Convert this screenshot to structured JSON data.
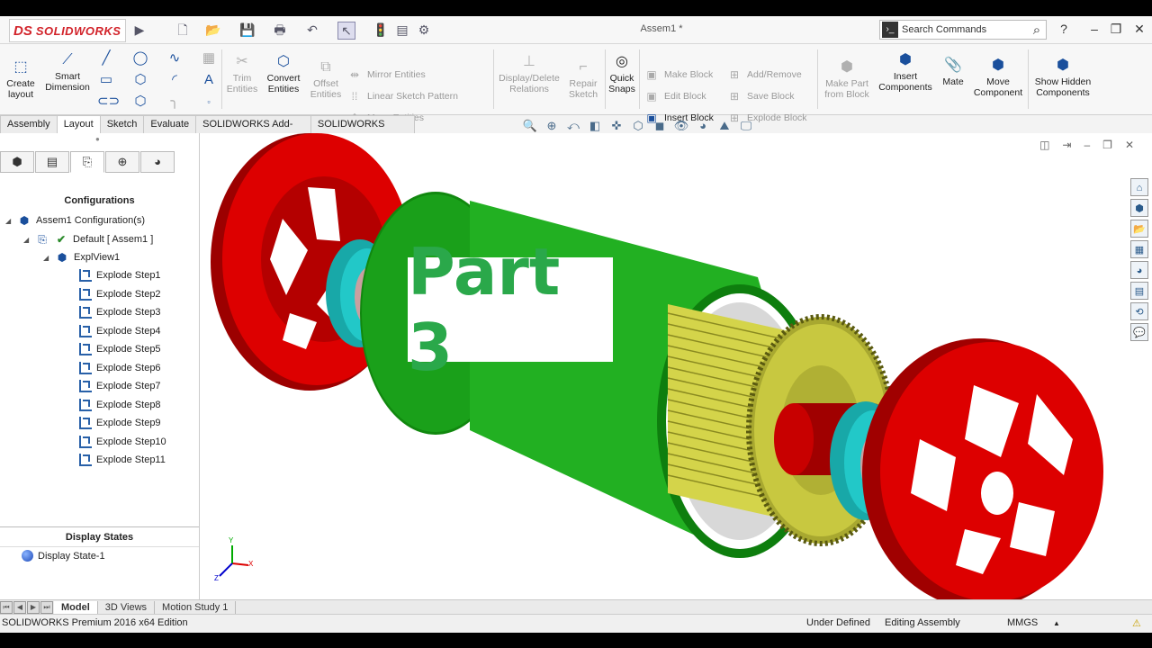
{
  "app": {
    "logo_ds": "DS",
    "logo_name": "SOLIDWORKS",
    "doc_title": "Assem1 *",
    "search_placeholder": "Search Commands",
    "help": "?"
  },
  "ribbon": {
    "create_layout": "Create layout",
    "smart_dimension": "Smart Dimension",
    "trim_entities": "Trim Entities",
    "convert_entities": "Convert Entities",
    "offset_entities": "Offset Entities",
    "mirror_entities": "Mirror Entities",
    "linear_sketch_pattern": "Linear Sketch Pattern",
    "move_entities": "Move Entities",
    "display_delete_relations": "Display/Delete Relations",
    "repair_sketch": "Repair Sketch",
    "quick_snaps": "Quick Snaps",
    "make_block": "Make Block",
    "edit_block": "Edit Block",
    "insert_block": "Insert Block",
    "add_remove": "Add/Remove",
    "save_block": "Save Block",
    "explode_block": "Explode Block",
    "make_part_from_block": "Make Part from Block",
    "insert_components": "Insert Components",
    "mate": "Mate",
    "move_component": "Move Component",
    "show_hidden_components": "Show Hidden Components"
  },
  "tabs": [
    "Assembly",
    "Layout",
    "Sketch",
    "Evaluate",
    "SOLIDWORKS Add-Ins",
    "SOLIDWORKS MBD"
  ],
  "panel": {
    "configurations_title": "Configurations",
    "root": "Assem1 Configuration(s)",
    "default": "Default [ Assem1 ]",
    "explview": "ExplView1",
    "steps": [
      "Explode Step1",
      "Explode Step2",
      "Explode Step3",
      "Explode Step4",
      "Explode Step5",
      "Explode Step6",
      "Explode Step7",
      "Explode Step8",
      "Explode Step9",
      "Explode Step10",
      "Explode Step11"
    ],
    "display_states_title": "Display States",
    "display_state": "Display State-1"
  },
  "viewport": {
    "overlay_text": "Part 3",
    "triad_x": "X",
    "triad_y": "Y",
    "triad_z": "Z"
  },
  "bottom_tabs": [
    "Model",
    "3D Views",
    "Motion Study 1"
  ],
  "status": {
    "edition": "SOLIDWORKS Premium 2016 x64 Edition",
    "state": "Under Defined",
    "mode": "Editing Assembly",
    "units": "MMGS",
    "units_arrow": "▲"
  },
  "colors": {
    "pulley": "#dd0000",
    "stator": "#1aa01a",
    "rotor": "#cccc33",
    "bearing": "#22c8c8",
    "overlay_text": "#2aa84a"
  }
}
